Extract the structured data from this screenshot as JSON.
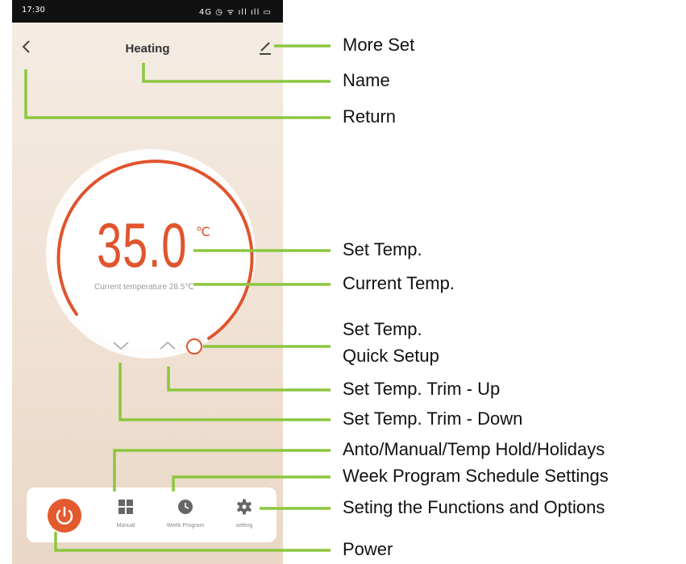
{
  "status_bar": {
    "time": "17:30",
    "icons": "4G ◷ ᯤ ıll ıll ▭"
  },
  "header": {
    "back_icon": "chevron-left-icon",
    "title": "Heating",
    "edit_icon": "pencil-icon"
  },
  "thermostat": {
    "set_temperature": "35.0",
    "unit": "℃",
    "current_temperature_label": "Current temperature 28.5℃"
  },
  "controls": {
    "trim_down_icon": "chevron-down-icon",
    "trim_up_icon": "chevron-up-icon",
    "quick_setup_icon": "circle-handle-icon"
  },
  "bottom_bar": {
    "power_icon": "power-icon",
    "mode_label": "Manual",
    "week_program_label": "Week Program",
    "setting_label": "setting"
  },
  "annotations": {
    "more_set": "More Set",
    "name": "Name",
    "return": "Return",
    "set_temp": "Set Temp.",
    "current_temp": "Current Temp.",
    "quick_setup_line1": "Set Temp.",
    "quick_setup_line2": "Quick Setup",
    "trim_up": "Set Temp. Trim - Up",
    "trim_down": "Set Temp. Trim - Down",
    "modes": "Anto/Manual/Temp Hold/Holidays",
    "week_program": "Week Program Schedule Settings",
    "functions": "Seting the Functions and Options",
    "power": "Power"
  },
  "colors": {
    "accent": "#e0542e",
    "leader": "#8cc63f"
  }
}
